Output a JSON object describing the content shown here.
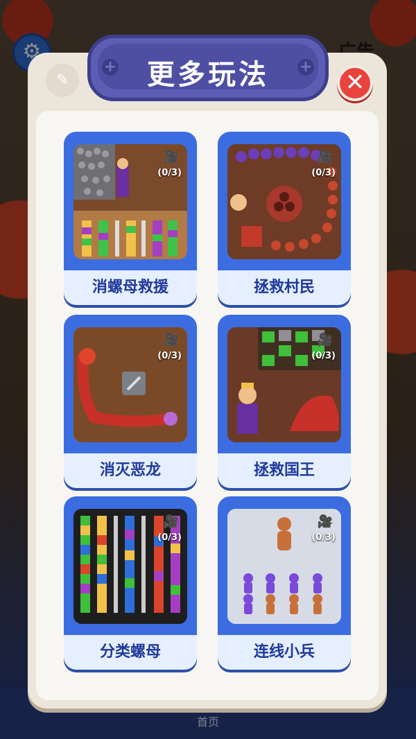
{
  "background": {
    "partial_text": "广告",
    "bottom_nav_label": "首页"
  },
  "dialog": {
    "title": "更多玩法",
    "close_symbol": "✕"
  },
  "games": [
    {
      "name": "消螺母救援",
      "progress": "(0/3)"
    },
    {
      "name": "拯救村民",
      "progress": "(0/3)"
    },
    {
      "name": "消灭恶龙",
      "progress": "(0/3)"
    },
    {
      "name": "拯救国王",
      "progress": "(0/3)"
    },
    {
      "name": "分类螺母",
      "progress": "(0/3)"
    },
    {
      "name": "连线小兵",
      "progress": "(0/3)"
    }
  ],
  "icons": {
    "settings": "gear-icon",
    "edit": "pencil-icon",
    "video": "video-camera-icon",
    "close": "close-icon"
  },
  "colors": {
    "title_plate": "#5c5db3",
    "card_blue": "#3b6de0",
    "close_red": "#e8433c",
    "label_text": "#1f3a9a"
  }
}
